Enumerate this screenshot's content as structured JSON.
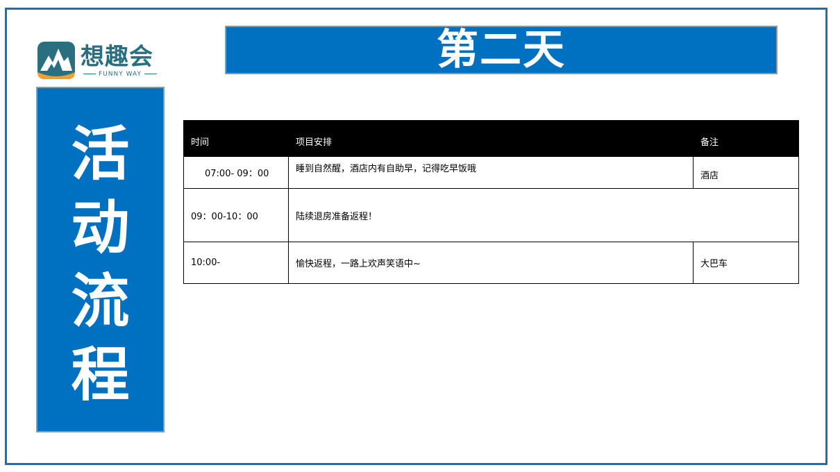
{
  "logo": {
    "name_cn": "想趣会",
    "name_en": "FUNNY WAY",
    "colors": {
      "teal": "#2a6f7f",
      "orange": "#f0a030"
    }
  },
  "title": "第二天",
  "side_label": [
    "活",
    "动",
    "流",
    "程"
  ],
  "table": {
    "headers": [
      "时间",
      "项目安排",
      "备注"
    ],
    "rows": [
      {
        "time": "07:00- 09：00",
        "task": "睡到自然醒，酒店内有自助早，记得吃早饭哦",
        "note": "酒店"
      },
      {
        "time": "09：00-10：00",
        "task": "陆续退房准备返程！",
        "note": ""
      },
      {
        "time": "10:00-",
        "task": "愉快返程，一路上欢声笑语中~",
        "note": "大巴车"
      }
    ]
  },
  "colors": {
    "primary_blue": "#0070c0",
    "frame_blue": "#1f6db4",
    "header_black": "#000000"
  }
}
